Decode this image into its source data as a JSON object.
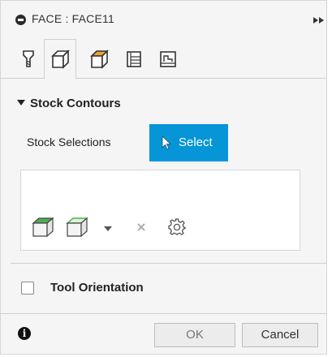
{
  "title": {
    "text": "FACE : FACE11"
  },
  "tabs": [
    {
      "icon": "tool-icon",
      "active": false
    },
    {
      "icon": "geometry-icon",
      "active": true
    },
    {
      "icon": "heights-icon",
      "active": false
    },
    {
      "icon": "passes-icon",
      "active": false
    },
    {
      "icon": "linking-icon",
      "active": false
    }
  ],
  "section": {
    "title": "Stock Contours",
    "expanded": true
  },
  "stock": {
    "label": "Stock Selections",
    "select_label": "Select"
  },
  "selection_tools": [
    "stock-box-green-top-icon",
    "stock-box-green-outline-icon",
    "dropdown-arrow-icon",
    "clear-x-icon",
    "settings-gear-icon"
  ],
  "tool_orientation": {
    "label": "Tool Orientation",
    "checked": false
  },
  "footer": {
    "ok_label": "OK",
    "cancel_label": "Cancel"
  },
  "colors": {
    "accent": "#0696d7",
    "tab_orange": "#f0a030",
    "green": "#4caf50"
  }
}
